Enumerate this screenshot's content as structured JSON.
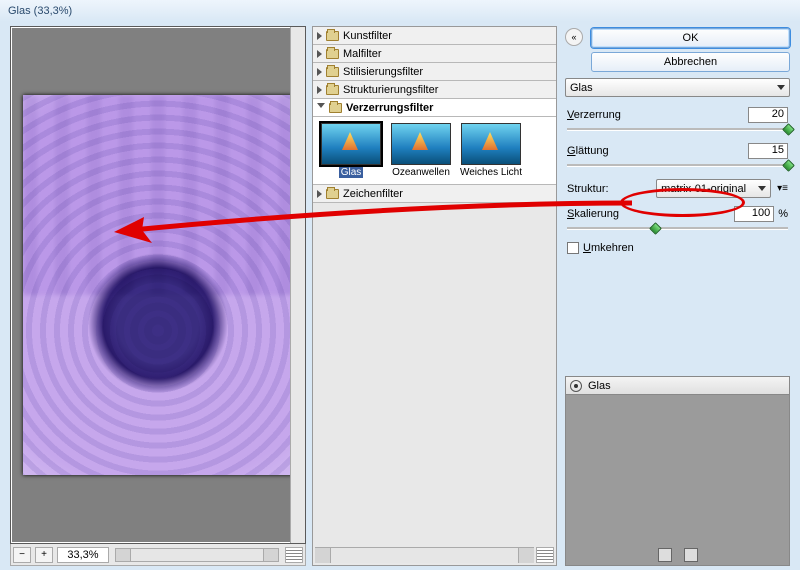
{
  "window": {
    "title": "Glas (33,3%)"
  },
  "preview": {
    "zoom": "33,3%",
    "minus": "−",
    "plus": "+"
  },
  "categories": [
    {
      "label": "Kunstfilter",
      "open": false
    },
    {
      "label": "Malfilter",
      "open": false
    },
    {
      "label": "Stilisierungsfilter",
      "open": false
    },
    {
      "label": "Strukturierungsfilter",
      "open": false
    },
    {
      "label": "Verzerrungsfilter",
      "open": true
    },
    {
      "label": "Zeichenfilter",
      "open": false
    }
  ],
  "thumbs": [
    {
      "caption": "Glas",
      "selected": true
    },
    {
      "caption": "Ozeanwellen",
      "selected": false
    },
    {
      "caption": "Weiches Licht",
      "selected": false
    }
  ],
  "buttons": {
    "ok": "OK",
    "cancel": "Abbrechen"
  },
  "filter_select": "Glas",
  "params": {
    "verzerrung": {
      "label": "Verzerrung",
      "underline": "V",
      "value": "20",
      "tick_pct": 98
    },
    "glaettung": {
      "label": "Glättung",
      "underline": "G",
      "value": "15",
      "tick_pct": 98
    },
    "struktur": {
      "label": "Struktur:",
      "value": "matrix-01-original"
    },
    "skalierung": {
      "label": "Skalierung",
      "underline": "S",
      "value": "100",
      "suffix": "%",
      "tick_pct": 38
    },
    "umkehren": {
      "label": "Umkehren",
      "underline": "U",
      "checked": false
    }
  },
  "layers": {
    "item": "Glas"
  }
}
